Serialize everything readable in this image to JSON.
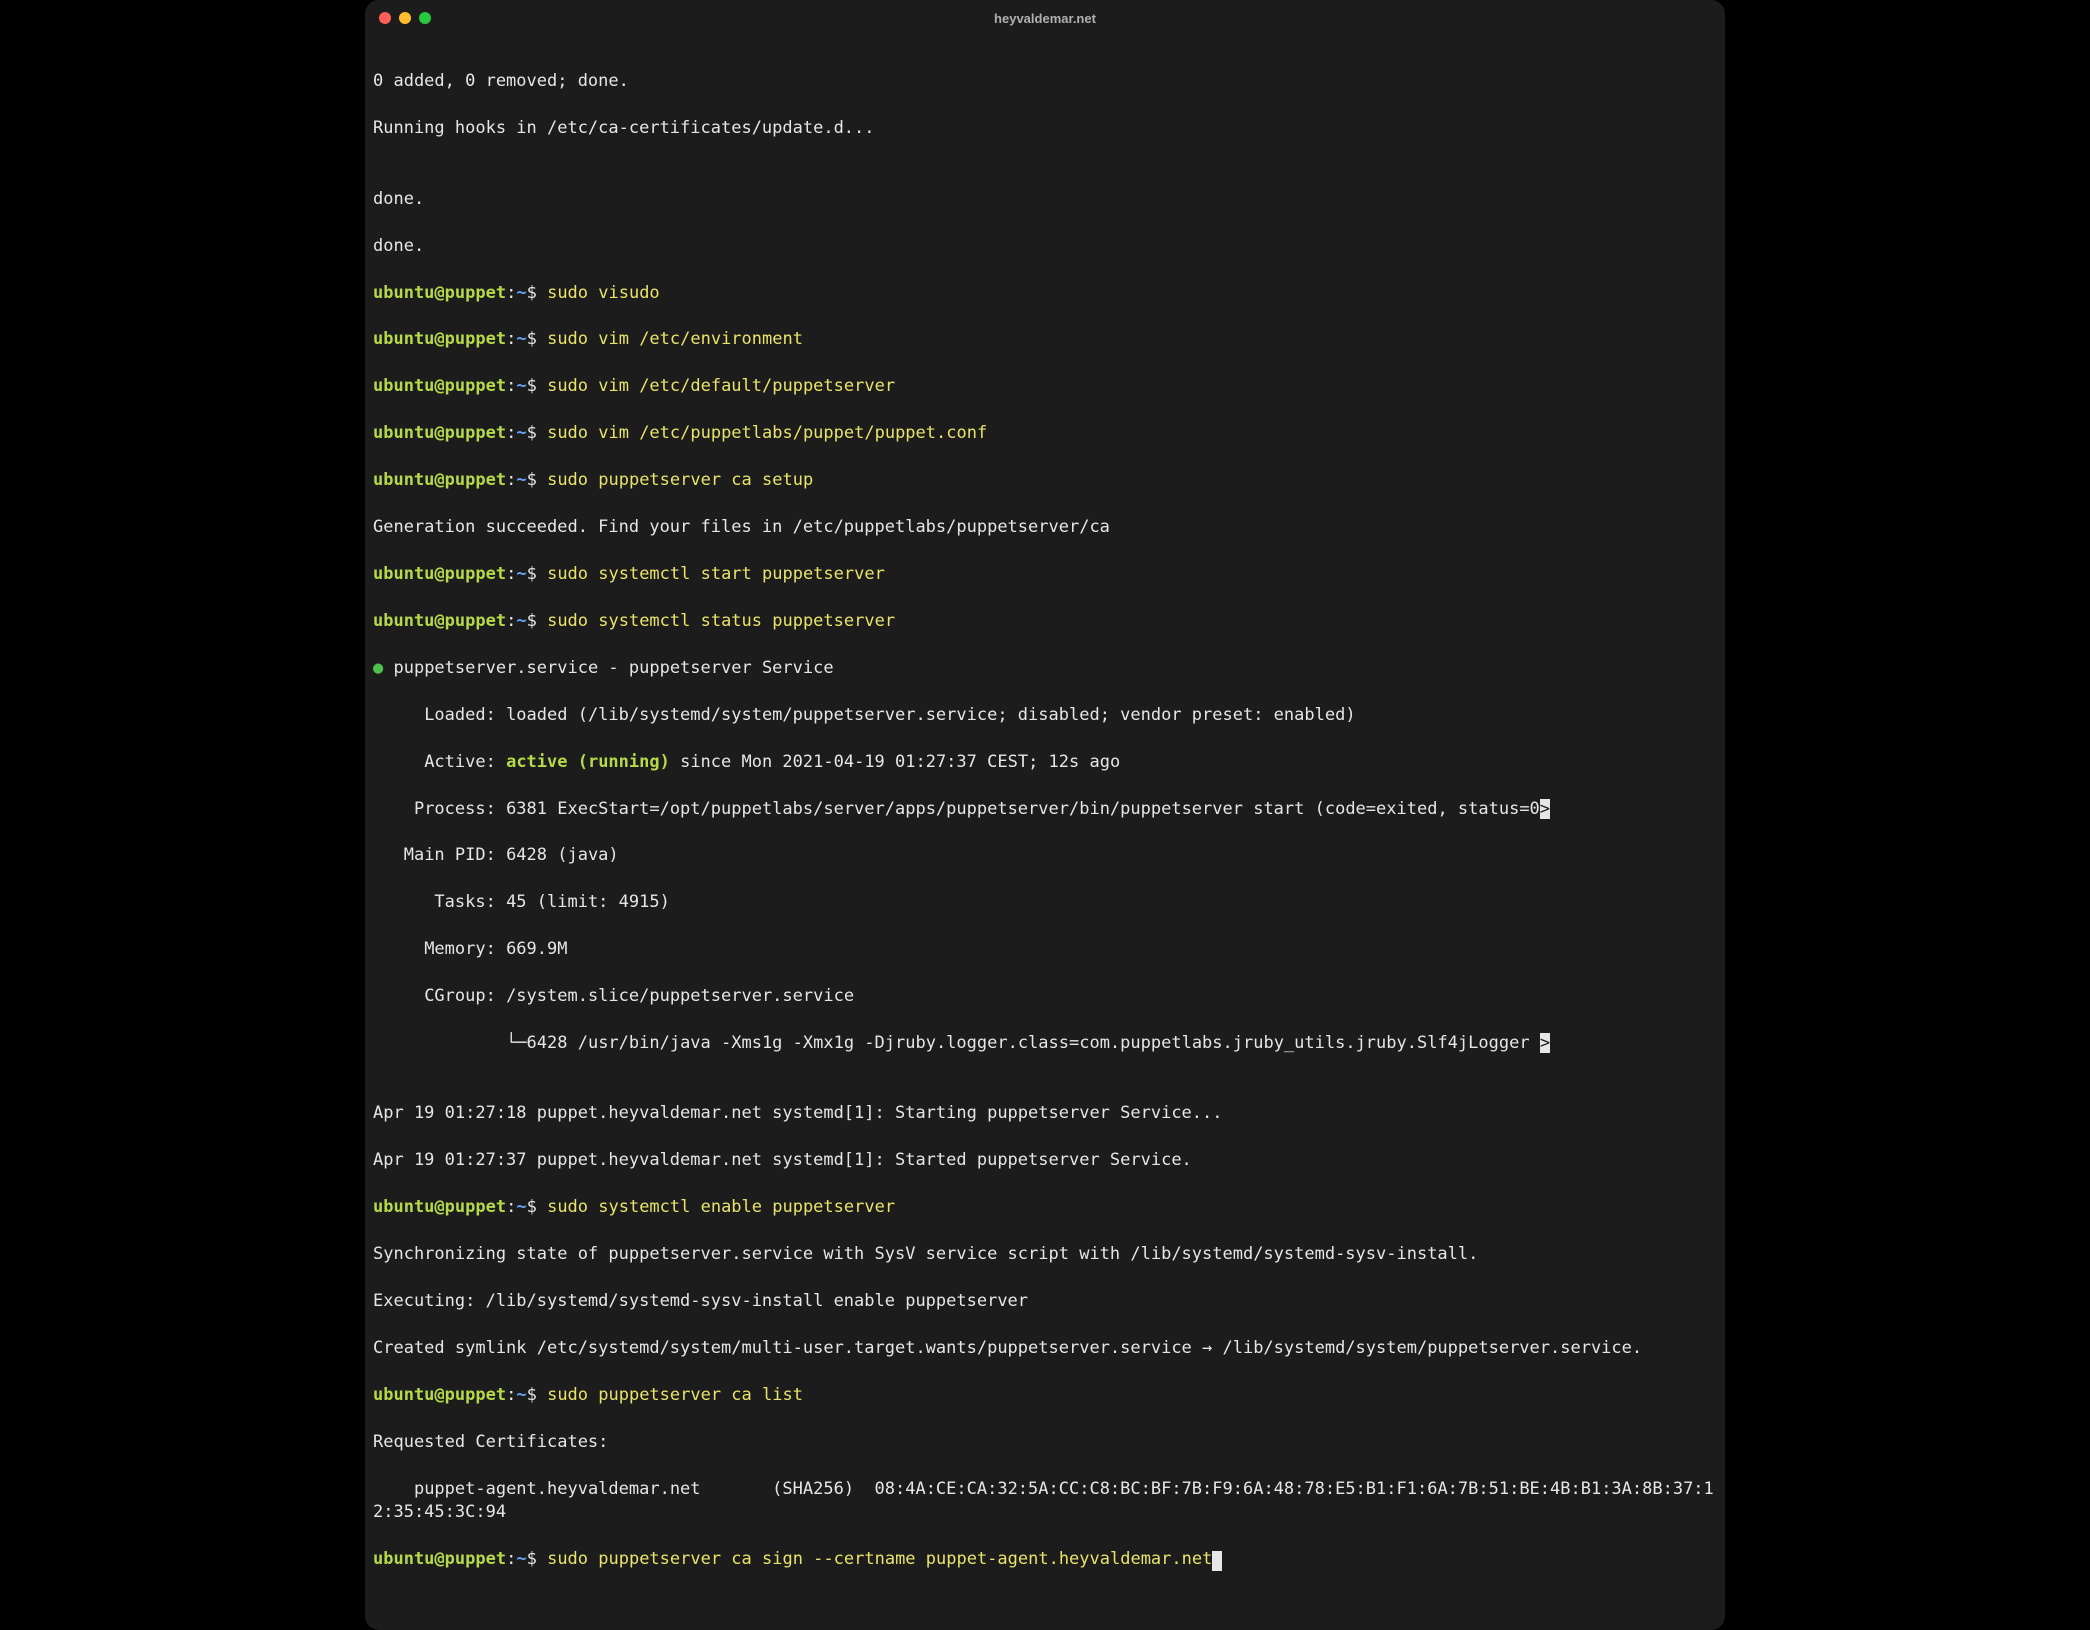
{
  "window": {
    "title": "heyvaldemar.net"
  },
  "prompt": {
    "user": "ubuntu",
    "at": "@",
    "host": "puppet",
    "colon": ":",
    "path": "~",
    "dollar": "$ "
  },
  "lines": {
    "l00": "0 added, 0 removed; done.",
    "l01": "Running hooks in /etc/ca-certificates/update.d...",
    "l02": "",
    "l03": "done.",
    "l04": "done.",
    "cmd01": "sudo visudo",
    "cmd02": "sudo vim /etc/environment",
    "cmd03": "sudo vim /etc/default/puppetserver",
    "cmd04": "sudo vim /etc/puppetlabs/puppet/puppet.conf",
    "cmd05": "sudo puppetserver ca setup",
    "l05": "Generation succeeded. Find your files in /etc/puppetlabs/puppetserver/ca",
    "cmd06": "sudo systemctl start puppetserver",
    "cmd07": "sudo systemctl status puppetserver",
    "l06a": "● ",
    "l06b": "puppetserver.service - puppetserver Service",
    "l07": "     Loaded: loaded (/lib/systemd/system/puppetserver.service; disabled; vendor preset: enabled)",
    "l08a": "     Active: ",
    "l08b": "active (running)",
    "l08c": " since Mon 2021-04-19 01:27:37 CEST; 12s ago",
    "l09a": "    Process: 6381 ExecStart=/opt/puppetlabs/server/apps/puppetserver/bin/puppetserver start (code=exited, status=0",
    "l09b": ">",
    "l10": "   Main PID: 6428 (java)",
    "l11": "      Tasks: 45 (limit: 4915)",
    "l12": "     Memory: 669.9M",
    "l13": "     CGroup: /system.slice/puppetserver.service",
    "l14a": "             └─",
    "l14b": "6428 /usr/bin/java -Xms1g -Xmx1g -Djruby.logger.class=com.puppetlabs.jruby_utils.jruby.Slf4jLogger ",
    "l14c": ">",
    "l15": "",
    "l16": "Apr 19 01:27:18 puppet.heyvaldemar.net systemd[1]: Starting puppetserver Service...",
    "l17": "Apr 19 01:27:37 puppet.heyvaldemar.net systemd[1]: Started puppetserver Service.",
    "cmd08": "sudo systemctl enable puppetserver",
    "l18": "Synchronizing state of puppetserver.service with SysV service script with /lib/systemd/systemd-sysv-install.",
    "l19": "Executing: /lib/systemd/systemd-sysv-install enable puppetserver",
    "l20": "Created symlink /etc/systemd/system/multi-user.target.wants/puppetserver.service → /lib/systemd/system/puppetserver.service.",
    "cmd09": "sudo puppetserver ca list",
    "l21": "Requested Certificates:",
    "l22": "    puppet-agent.heyvaldemar.net       (SHA256)  08:4A:CE:CA:32:5A:CC:C8:BC:BF:7B:F9:6A:48:78:E5:B1:F1:6A:7B:51:BE:4B:B1:3A:8B:37:12:35:45:3C:94",
    "cmd10": "sudo puppetserver ca sign --certname puppet-agent.heyvaldemar.net"
  }
}
